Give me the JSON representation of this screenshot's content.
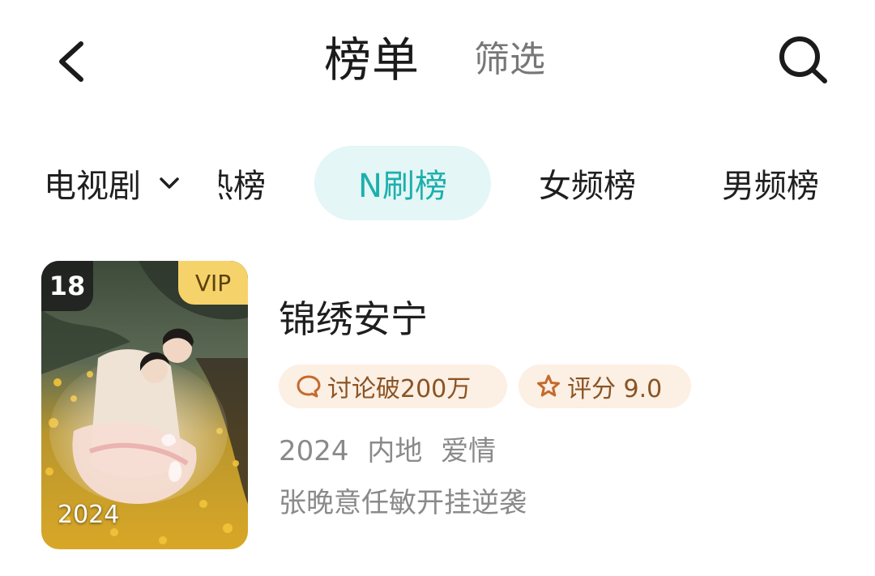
{
  "header": {
    "title": "榜单",
    "filter_label": "筛选",
    "back_icon": "chevron-left-icon",
    "search_icon": "search-icon"
  },
  "tabs": {
    "category": "电视剧",
    "dropdown_icon": "chevron-down-icon",
    "items": [
      {
        "label": "热播榜",
        "visible_text": "热榜",
        "state": "partially-scrolled"
      },
      {
        "label": "N刷榜",
        "state": "active"
      },
      {
        "label": "女频榜",
        "state": "inactive"
      },
      {
        "label": "男频榜",
        "state": "inactive"
      }
    ],
    "active_color": "#1cb0ad",
    "active_bg": "#e4f6f5"
  },
  "show": {
    "rank": "18",
    "vip_label": "VIP",
    "poster_year": "2024",
    "title": "锦绣安宁",
    "discussion": "讨论破200万",
    "score": "评分 9.0",
    "year": "2024",
    "region": "内地",
    "genre": "爱情",
    "description": "张晚意任敏开挂逆袭",
    "chip_bg": "#fcefe3",
    "chip_color": "#8a5424"
  }
}
